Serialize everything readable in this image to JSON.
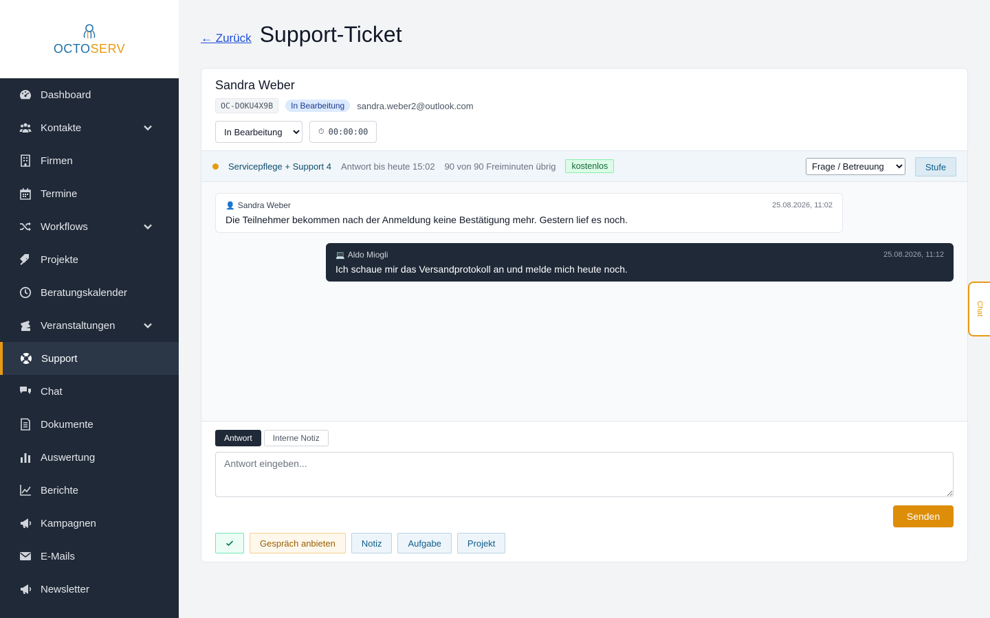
{
  "brand": {
    "logo_text_1": "OCTO",
    "logo_text_2": "SERV",
    "primary_color": "#1e6fa8",
    "accent_color": "#e89a12"
  },
  "sidebar": {
    "items": [
      {
        "label": "Dashboard",
        "icon": "dashboard-icon",
        "has_submenu": false,
        "active": false
      },
      {
        "label": "Kontakte",
        "icon": "users-icon",
        "has_submenu": true,
        "active": false
      },
      {
        "label": "Firmen",
        "icon": "building-icon",
        "has_submenu": false,
        "active": false
      },
      {
        "label": "Termine",
        "icon": "calendar-icon",
        "has_submenu": false,
        "active": false
      },
      {
        "label": "Workflows",
        "icon": "shuffle-icon",
        "has_submenu": true,
        "active": false
      },
      {
        "label": "Projekte",
        "icon": "tags-icon",
        "has_submenu": false,
        "active": false
      },
      {
        "label": "Beratungskalender",
        "icon": "clock-icon",
        "has_submenu": false,
        "active": false
      },
      {
        "label": "Veranstaltungen",
        "icon": "tickets-icon",
        "has_submenu": true,
        "active": false
      },
      {
        "label": "Support",
        "icon": "lifebuoy-icon",
        "has_submenu": false,
        "active": true
      },
      {
        "label": "Chat",
        "icon": "comments-icon",
        "has_submenu": false,
        "active": false
      },
      {
        "label": "Dokumente",
        "icon": "document-icon",
        "has_submenu": false,
        "active": false
      },
      {
        "label": "Auswertung",
        "icon": "bar-chart-icon",
        "has_submenu": false,
        "active": false
      },
      {
        "label": "Berichte",
        "icon": "line-chart-icon",
        "has_submenu": false,
        "active": false
      },
      {
        "label": "Kampagnen",
        "icon": "megaphone-icon",
        "has_submenu": false,
        "active": false
      },
      {
        "label": "E-Mails",
        "icon": "envelope-icon",
        "has_submenu": false,
        "active": false
      },
      {
        "label": "Newsletter",
        "icon": "megaphone-icon",
        "has_submenu": false,
        "active": false
      }
    ]
  },
  "header": {
    "back_label": "← Zurück",
    "title": "Support-Ticket"
  },
  "ticket": {
    "customer_name": "Sandra Weber",
    "ticket_id": "OC-DOKU4X9B",
    "status_badge": "In Bearbeitung",
    "email": "sandra.weber2@outlook.com",
    "status_select_value": "In Bearbeitung",
    "timer": "00:00:00",
    "timer_icon": "⏱"
  },
  "contract": {
    "name": "Servicepflege + Support 4",
    "response_due": "Antwort bis heute 15:02",
    "free_minutes": "90 von 90 Freiminuten übrig",
    "free_badge": "kostenlos",
    "category_value": "Frage / Betreuung",
    "level_button": "Stufe"
  },
  "messages": [
    {
      "author": "Sandra Weber",
      "author_icon": "👤",
      "time": "25.08.2026, 11:02",
      "text": "Die Teilnehmer bekommen nach der Anmeldung keine Bestätigung mehr. Gestern lief es noch."
    },
    {
      "author": "Aldo Miogli",
      "author_icon": "💻",
      "time": "25.08.2026, 11:12",
      "text": "Ich schaue mir das Versandprotokoll an und melde mich heute noch."
    }
  ],
  "reply": {
    "tab_reply": "Antwort",
    "tab_note": "Interne Notiz",
    "placeholder": "Antwort eingeben...",
    "send_label": "Senden"
  },
  "actions": {
    "offer_call": "Gespräch anbieten",
    "note": "Notiz",
    "task": "Aufgabe",
    "project": "Projekt"
  },
  "chat_tab": {
    "label": "Chat"
  }
}
